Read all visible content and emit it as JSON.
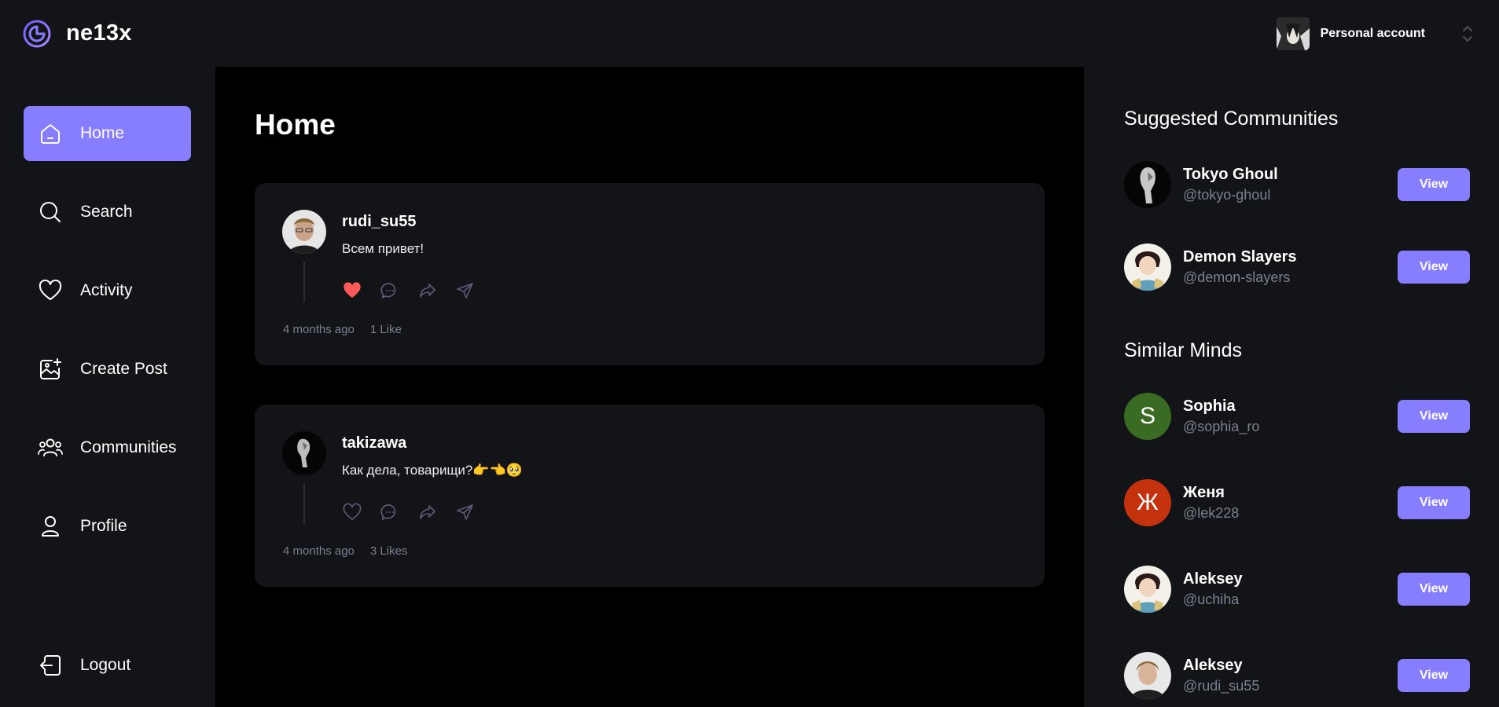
{
  "app": {
    "name": "ne13x"
  },
  "account": {
    "label": "Personal account"
  },
  "nav": {
    "items": [
      {
        "label": "Home",
        "icon": "home-icon"
      },
      {
        "label": "Search",
        "icon": "search-icon"
      },
      {
        "label": "Activity",
        "icon": "heart-icon"
      },
      {
        "label": "Create Post",
        "icon": "image-add-icon"
      },
      {
        "label": "Communities",
        "icon": "users-icon"
      },
      {
        "label": "Profile",
        "icon": "user-icon"
      }
    ],
    "logout": "Logout"
  },
  "main": {
    "title": "Home",
    "posts": [
      {
        "author": "rudi_su55",
        "text": "Всем привет!",
        "time": "4 months ago",
        "likes": "1 Like",
        "liked": true
      },
      {
        "author": "takizawa",
        "text": "Как дела, товарищи?👉👈🥺",
        "time": "4 months ago",
        "likes": "3 Likes",
        "liked": false
      }
    ]
  },
  "suggested": {
    "title": "Suggested Communities",
    "items": [
      {
        "name": "Tokyo Ghoul",
        "handle": "@tokyo-ghoul",
        "button": "View"
      },
      {
        "name": "Demon Slayers",
        "handle": "@demon-slayers",
        "button": "View"
      }
    ]
  },
  "similar": {
    "title": "Similar Minds",
    "items": [
      {
        "name": "Sophia",
        "handle": "@sophia_ro",
        "initial": "S",
        "color": "#3a6b23",
        "button": "View"
      },
      {
        "name": "Женя",
        "handle": "@lek228",
        "initial": "Ж",
        "color": "#c4320e",
        "button": "View"
      },
      {
        "name": "Aleksey",
        "handle": "@uchiha",
        "button": "View"
      },
      {
        "name": "Aleksey",
        "handle": "@rudi_su55",
        "button": "View"
      }
    ]
  },
  "colors": {
    "accent": "#877EFF",
    "like": "#FF5A5A",
    "panel": "#121417"
  }
}
